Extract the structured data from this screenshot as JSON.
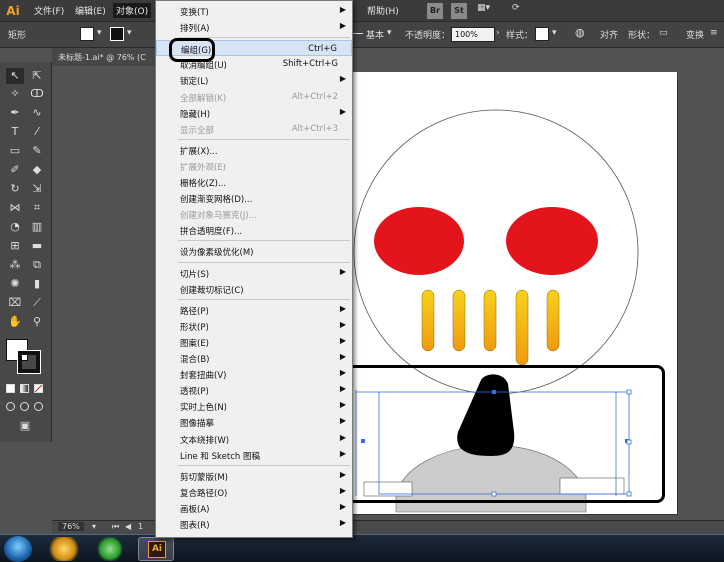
{
  "app": {
    "logo": "Ai"
  },
  "menubar": {
    "items": [
      "文件(F)",
      "编辑(E)",
      "对象(O)"
    ],
    "window_item": "帮助(H)",
    "badges": [
      "Br",
      "St"
    ]
  },
  "controlbar": {
    "tool_name": "矩形",
    "stroke_style": "基本",
    "opacity_label": "不透明度：",
    "opacity_value": "100%",
    "style_label": "样式：",
    "align_label": "对齐",
    "shape_label": "形状：",
    "transform_label": "变换"
  },
  "document": {
    "tab_title": "未标题-1.ai* @ 76% (C"
  },
  "status": {
    "zoom": "76%",
    "page": "1"
  },
  "object_menu": {
    "items": [
      {
        "label": "变换(T)",
        "shortcut": "",
        "submenu": true,
        "disabled": false
      },
      {
        "label": "排列(A)",
        "shortcut": "",
        "submenu": true,
        "disabled": false
      },
      {
        "sep": true
      },
      {
        "label": "编组(G)",
        "shortcut": "Ctrl+G",
        "submenu": false,
        "disabled": false,
        "highlight": true
      },
      {
        "label": "取消编组(U)",
        "shortcut": "Shift+Ctrl+G",
        "submenu": false,
        "disabled": false
      },
      {
        "label": "锁定(L)",
        "shortcut": "",
        "submenu": true,
        "disabled": false
      },
      {
        "label": "全部解锁(K)",
        "shortcut": "Alt+Ctrl+2",
        "submenu": false,
        "disabled": true
      },
      {
        "label": "隐藏(H)",
        "shortcut": "",
        "submenu": true,
        "disabled": false
      },
      {
        "label": "显示全部",
        "shortcut": "Alt+Ctrl+3",
        "submenu": false,
        "disabled": true
      },
      {
        "sep": true
      },
      {
        "label": "扩展(X)...",
        "shortcut": "",
        "submenu": false,
        "disabled": false
      },
      {
        "label": "扩展外观(E)",
        "shortcut": "",
        "submenu": false,
        "disabled": true
      },
      {
        "label": "栅格化(Z)...",
        "shortcut": "",
        "submenu": false,
        "disabled": false
      },
      {
        "label": "创建渐变网格(D)...",
        "shortcut": "",
        "submenu": false,
        "disabled": false
      },
      {
        "label": "创建对象马赛克(J)...",
        "shortcut": "",
        "submenu": false,
        "disabled": true
      },
      {
        "label": "拼合透明度(F)...",
        "shortcut": "",
        "submenu": false,
        "disabled": false
      },
      {
        "sep": true
      },
      {
        "label": "设为像素级优化(M)",
        "shortcut": "",
        "submenu": false,
        "disabled": false
      },
      {
        "sep": true
      },
      {
        "label": "切片(S)",
        "shortcut": "",
        "submenu": true,
        "disabled": false
      },
      {
        "label": "创建裁切标记(C)",
        "shortcut": "",
        "submenu": false,
        "disabled": false
      },
      {
        "sep": true
      },
      {
        "label": "路径(P)",
        "shortcut": "",
        "submenu": true,
        "disabled": false
      },
      {
        "label": "形状(P)",
        "shortcut": "",
        "submenu": true,
        "disabled": false
      },
      {
        "label": "图案(E)",
        "shortcut": "",
        "submenu": true,
        "disabled": false
      },
      {
        "label": "混合(B)",
        "shortcut": "",
        "submenu": true,
        "disabled": false
      },
      {
        "label": "封套扭曲(V)",
        "shortcut": "",
        "submenu": true,
        "disabled": false
      },
      {
        "label": "透视(P)",
        "shortcut": "",
        "submenu": true,
        "disabled": false
      },
      {
        "label": "实时上色(N)",
        "shortcut": "",
        "submenu": true,
        "disabled": false
      },
      {
        "label": "图像描摹",
        "shortcut": "",
        "submenu": true,
        "disabled": false
      },
      {
        "label": "文本绕排(W)",
        "shortcut": "",
        "submenu": true,
        "disabled": false
      },
      {
        "label": "Line 和 Sketch 图稿",
        "shortcut": "",
        "submenu": true,
        "disabled": false
      },
      {
        "sep": true
      },
      {
        "label": "剪切蒙版(M)",
        "shortcut": "",
        "submenu": true,
        "disabled": false
      },
      {
        "label": "复合路径(O)",
        "shortcut": "",
        "submenu": true,
        "disabled": false
      },
      {
        "label": "画板(A)",
        "shortcut": "",
        "submenu": true,
        "disabled": false
      },
      {
        "label": "图表(R)",
        "shortcut": "",
        "submenu": true,
        "disabled": false
      }
    ]
  },
  "colors": {
    "eye_red": "#e3141c",
    "tooth_top": "#f7d21a",
    "tooth_bottom": "#f09a10",
    "nose": "#000000",
    "chin_gray": "#cccccc",
    "selection_blue": "#3a6fd8"
  }
}
